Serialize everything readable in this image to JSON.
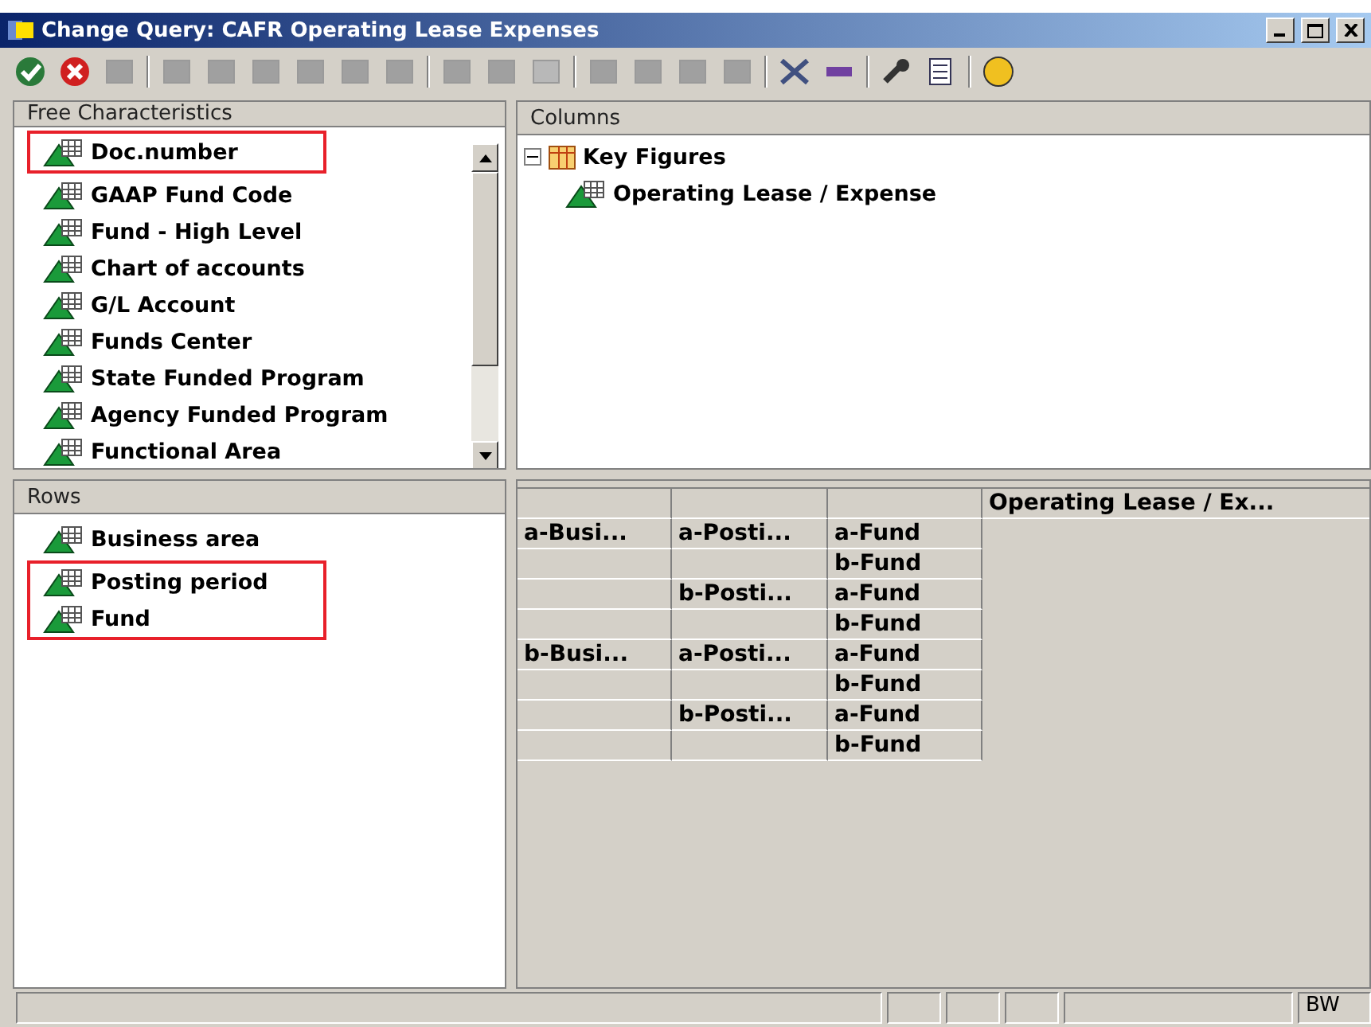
{
  "window": {
    "title": "Change Query: CAFR Operating Lease Expenses"
  },
  "free_characteristics": {
    "header": "Free Characteristics",
    "items": [
      {
        "label": "Doc.number",
        "highlighted": true
      },
      {
        "label": "GAAP Fund Code",
        "highlighted": false
      },
      {
        "label": "Fund - High Level",
        "highlighted": false
      },
      {
        "label": "Chart of accounts",
        "highlighted": false
      },
      {
        "label": "G/L Account",
        "highlighted": false
      },
      {
        "label": "Funds Center",
        "highlighted": false
      },
      {
        "label": "State Funded Program",
        "highlighted": false
      },
      {
        "label": "Agency Funded Program",
        "highlighted": false
      },
      {
        "label": "Functional Area",
        "highlighted": false
      }
    ]
  },
  "columns": {
    "header": "Columns",
    "tree": [
      {
        "label": "Key Figures",
        "expanded": true,
        "children": [
          {
            "label": "Operating Lease /  Expense"
          }
        ]
      }
    ]
  },
  "rows": {
    "header": "Rows",
    "items": [
      {
        "label": "Business area",
        "highlighted": false
      },
      {
        "label": "Posting period",
        "highlighted": true
      },
      {
        "label": "Fund",
        "highlighted": true
      }
    ]
  },
  "preview": {
    "column_header": "Operating Lease /  Ex...",
    "rows": [
      {
        "col_1": "a-Busi...",
        "col_2": "a-Posti...",
        "col_3": "a-Fund"
      },
      {
        "col_3": "b-Fund"
      },
      {
        "col_2": "b-Posti...",
        "col_3": "a-Fund"
      },
      {
        "col_3": "b-Fund"
      },
      {
        "col_1": "b-Busi...",
        "col_2": "a-Posti...",
        "col_3": "a-Fund"
      },
      {
        "col_3": "b-Fund"
      },
      {
        "col_2": "b-Posti...",
        "col_3": "a-Fund"
      },
      {
        "col_3": "b-Fund"
      }
    ]
  },
  "status_bar": {
    "system": "BW"
  }
}
